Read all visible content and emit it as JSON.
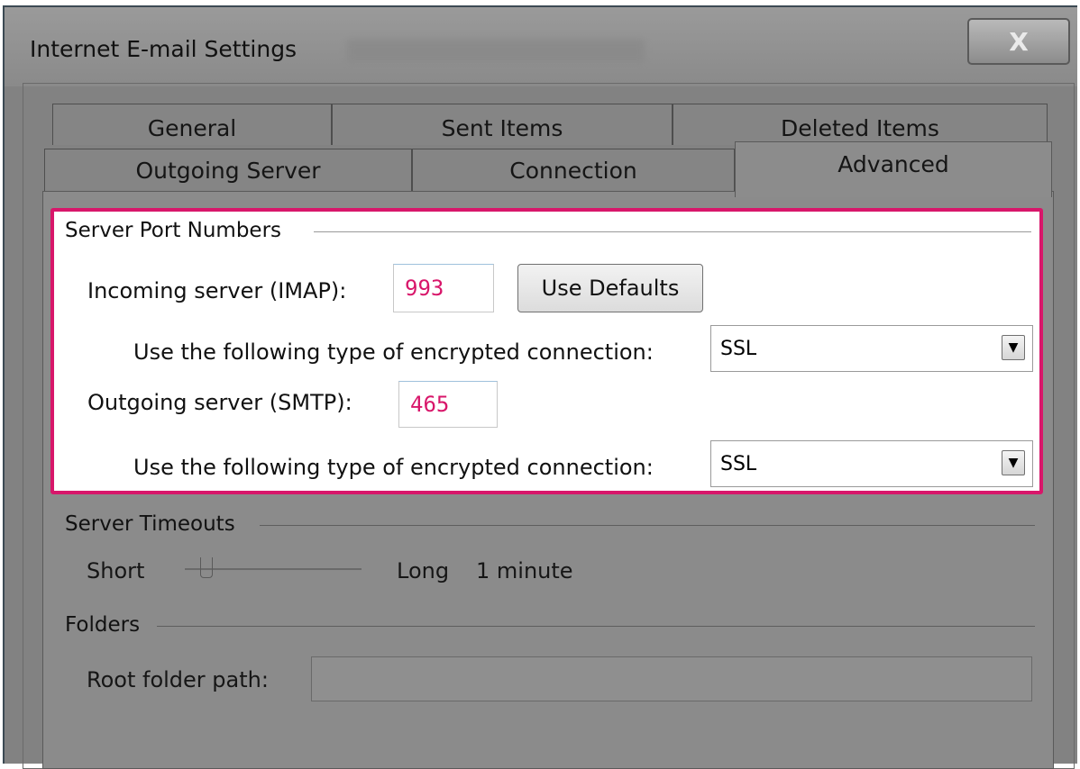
{
  "window": {
    "title": "Internet E-mail Settings",
    "close_glyph": "X"
  },
  "tabs": {
    "row1": [
      "General",
      "Sent Items",
      "Deleted Items"
    ],
    "row2": [
      "Outgoing Server",
      "Connection",
      "Advanced"
    ],
    "active": "Advanced"
  },
  "port_numbers": {
    "group_label": "Server Port Numbers",
    "incoming_label": "Incoming server (IMAP):",
    "incoming_value": "993",
    "use_defaults_label": "Use Defaults",
    "incoming_encryption_label": "Use the following type of encrypted connection:",
    "incoming_encryption_value": "SSL",
    "outgoing_label": "Outgoing server (SMTP):",
    "outgoing_value": "465",
    "outgoing_encryption_label": "Use the following type of encrypted connection:",
    "outgoing_encryption_value": "SSL"
  },
  "timeouts": {
    "group_label": "Server Timeouts",
    "short_label": "Short",
    "long_label": "Long",
    "value_label": "1 minute",
    "slider_level": 0.1
  },
  "folders": {
    "group_label": "Folders",
    "root_label": "Root folder path:",
    "root_value": ""
  },
  "colors": {
    "highlight": "#d8166a",
    "window_bg": "#828282"
  },
  "icons": {
    "close": "close-icon",
    "dropdown": "chevron-down-icon"
  }
}
